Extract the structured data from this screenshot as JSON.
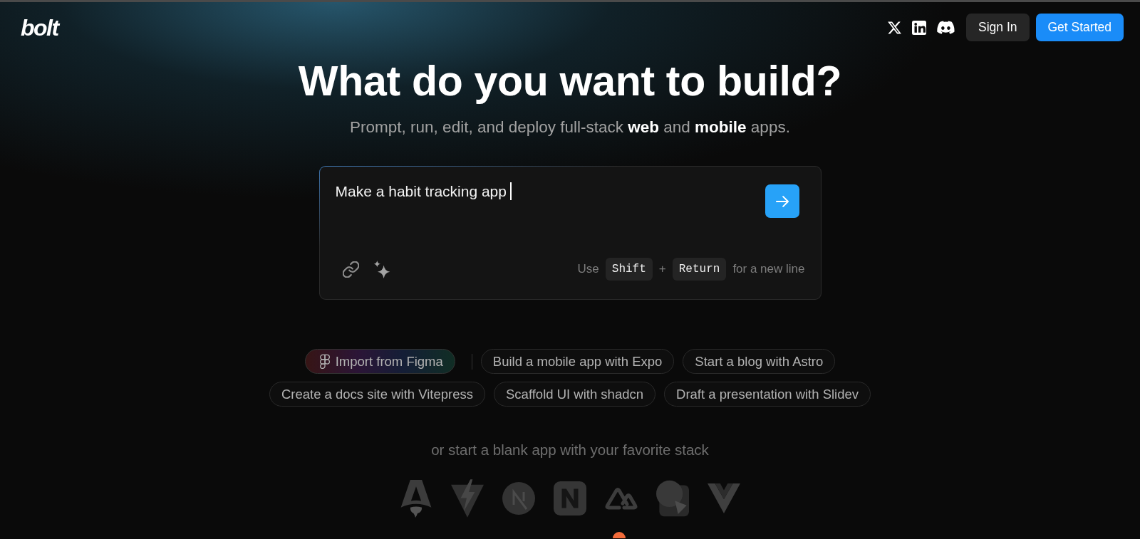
{
  "header": {
    "logo": "bolt",
    "buttons": [
      {
        "label": "Sign In",
        "kind": "secondary"
      },
      {
        "label": "Get Started",
        "kind": "primary"
      }
    ]
  },
  "hero": {
    "title": "What do you want to build?",
    "subtitle": "Prompt, run, edit, and deploy full-stack **web** and **mobile** apps."
  },
  "prompt": {
    "value": "Make a habit tracking app",
    "hint": [
      {
        "kind": "text",
        "text": "Use"
      },
      {
        "kind": "key",
        "text": "Shift"
      },
      {
        "kind": "text",
        "text": "+"
      },
      {
        "kind": "key",
        "text": "Return"
      },
      {
        "kind": "text",
        "text": "for a new line"
      }
    ]
  },
  "suggestions": [
    [
      {
        "kind": "import",
        "label": "Import from Figma"
      },
      {
        "kind": "prompt",
        "label": "Build a mobile app with Expo"
      },
      {
        "kind": "prompt",
        "label": "Start a blog with Astro"
      }
    ],
    [
      {
        "kind": "prompt",
        "label": "Create a docs site with Vitepress"
      },
      {
        "kind": "prompt",
        "label": "Scaffold UI with shadcn"
      },
      {
        "kind": "prompt",
        "label": "Draft a presentation with Slidev"
      }
    ]
  ],
  "stack_prompt": "or start a blank app with your favorite stack"
}
